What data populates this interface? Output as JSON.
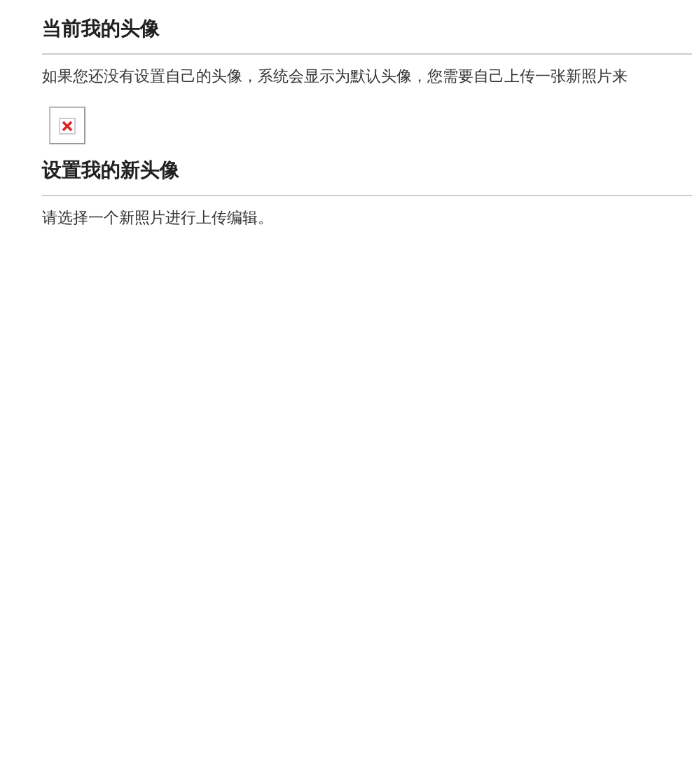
{
  "current_avatar": {
    "title": "当前我的头像",
    "description": "如果您还没有设置自己的头像，系统会显示为默认头像，您需要自己上传一张新照片来"
  },
  "new_avatar": {
    "title": "设置我的新头像",
    "description": "请选择一个新照片进行上传编辑。"
  }
}
